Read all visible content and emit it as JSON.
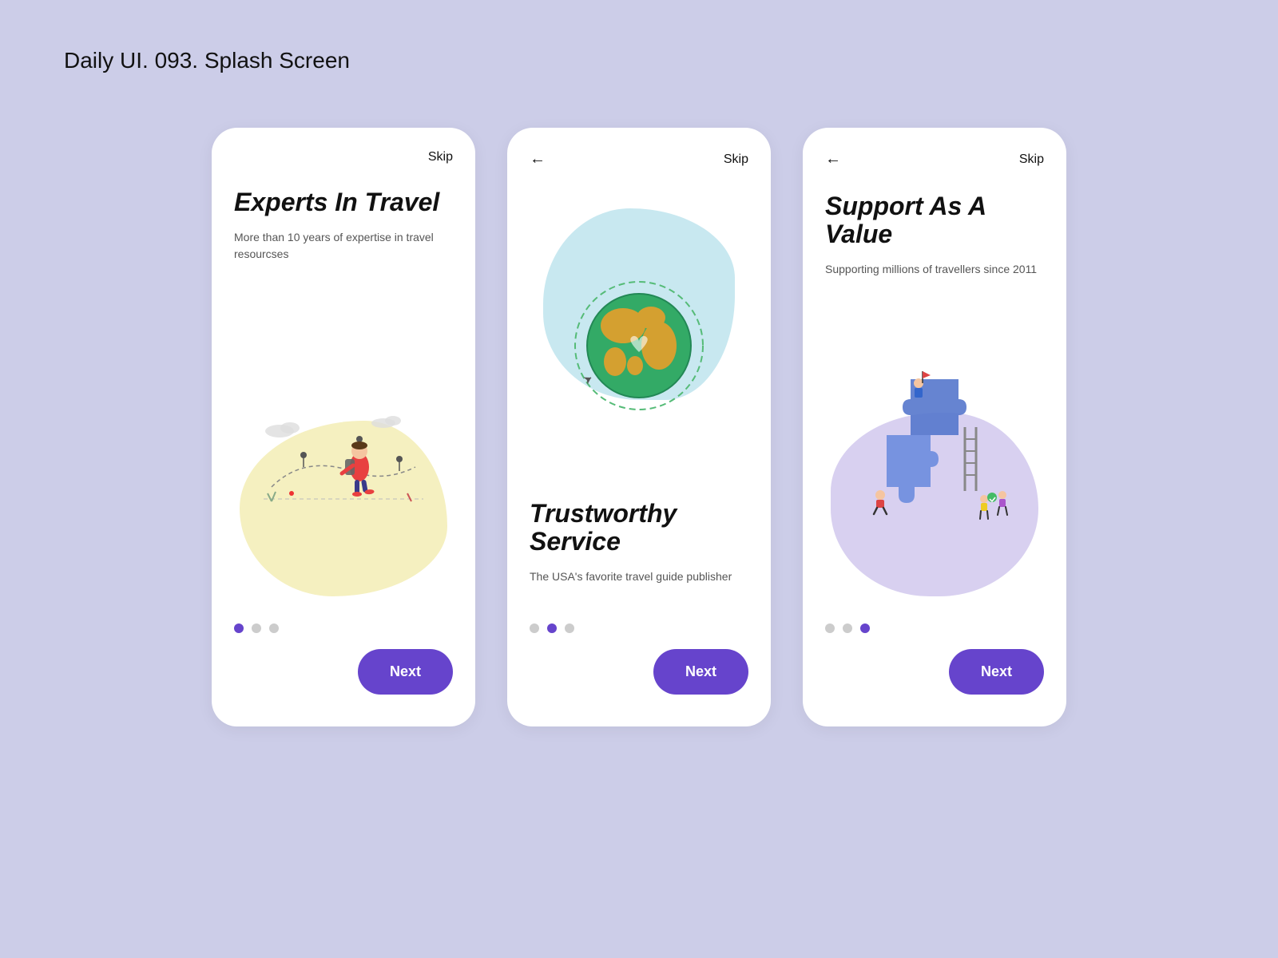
{
  "page": {
    "title": "Daily UI. 093. Splash Screen",
    "background_color": "#cccde8"
  },
  "cards": [
    {
      "id": "card1",
      "has_back": false,
      "skip_label": "Skip",
      "title": "Experts In Travel",
      "subtitle": "More than 10 years of expertise in travel resourcses",
      "illustration": "traveler",
      "dots": [
        true,
        false,
        false
      ],
      "next_label": "Next"
    },
    {
      "id": "card2",
      "has_back": true,
      "skip_label": "Skip",
      "title": "Trustworthy Service",
      "subtitle": "The USA's favorite travel guide publisher",
      "illustration": "globe",
      "dots": [
        false,
        true,
        false
      ],
      "next_label": "Next"
    },
    {
      "id": "card3",
      "has_back": true,
      "skip_label": "Skip",
      "title": "Support As A Value",
      "subtitle": "Supporting millions of travellers since 2011",
      "illustration": "puzzle",
      "dots": [
        false,
        false,
        true
      ],
      "next_label": "Next"
    }
  ]
}
